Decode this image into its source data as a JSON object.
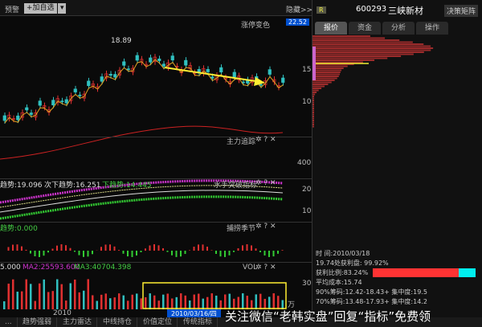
{
  "toolbar": {
    "alert": "预警",
    "add_watch": "+加自选",
    "dropdown": "▾",
    "hide": "隐藏>>",
    "limit_color": "涨停变色",
    "price_badge": "22.52"
  },
  "main_chart": {
    "high_label": "18.89",
    "axis": [
      "15",
      "10"
    ]
  },
  "panels": [
    {
      "title": "主力追踪",
      "axis": [
        "400"
      ]
    },
    {
      "title": "水手突破指标",
      "legend": [
        "趋势:19.096",
        "次下趋势:16.251",
        "下趋势:14.445"
      ],
      "axis": [
        "20",
        "10"
      ]
    },
    {
      "title": "捕捞季节",
      "legend": [
        "趋势:0.000"
      ]
    },
    {
      "title": "VOL",
      "legend": [
        "5.000",
        "MA2:25593.600",
        "MA3:40704.398"
      ],
      "axis": [
        "30",
        "万"
      ]
    }
  ],
  "panel_icons": [
    "gear-icon",
    "help-icon",
    "close-icon"
  ],
  "date_axis": {
    "year": "2010",
    "cursor": "2010/03/16/四"
  },
  "right": {
    "badge": "R",
    "code": "600293",
    "name": "三峡新材",
    "decision": "决策矩阵",
    "tabs": [
      "报价",
      "资金",
      "分析",
      "操作"
    ],
    "info": {
      "time": "时        间:2010/03/18",
      "profit_at": "19.74处获利盘: 99.92%",
      "profit_ratio": "获利比例:83.24%",
      "avg_cost": "平均成本:15.74",
      "c90": "90%筹码:12.42-18.43+ 集中度:19.5",
      "c70": "70%筹码:13.48-17.93+ 集中度:14.2"
    },
    "profit_ratio_pct": 83.24
  },
  "bottom_tabs": [
    "...",
    "趋势强弱",
    "主力雷达",
    "中线持仓",
    "价值定位",
    "传统指标"
  ],
  "watermark": "关注微信“老韩实盘”回复“指标”免费领",
  "colors": {
    "up": "#e03030",
    "down": "#30c0c0",
    "ma": "#e0a020",
    "arrow": "#ffee33",
    "accent": "#0050d0"
  },
  "chart_data": {
    "type": "candlestick",
    "closes": [
      11,
      11.5,
      12,
      12.5,
      13,
      13.6,
      14.2,
      15,
      16,
      16.8,
      17.5,
      18.2,
      18.5,
      18.3,
      18,
      17.6,
      17.2,
      16.8,
      16.5,
      16.2,
      16,
      15.8,
      16.3,
      15.6
    ],
    "ylim": [
      9,
      23
    ]
  }
}
